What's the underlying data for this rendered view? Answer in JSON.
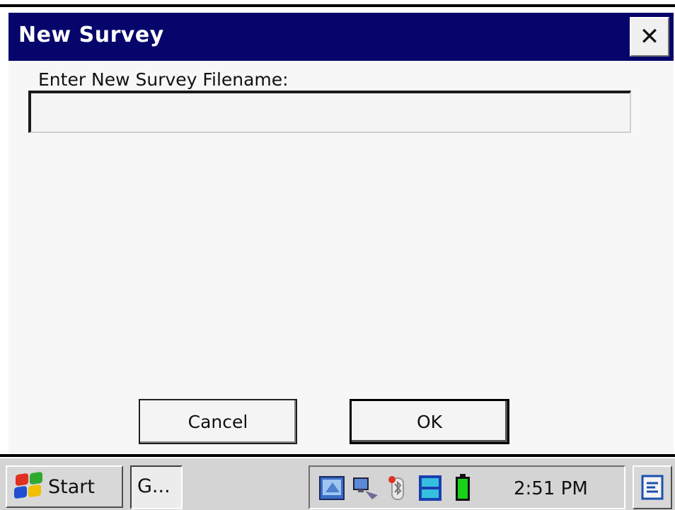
{
  "window": {
    "title": "New Survey",
    "close_glyph": "✕",
    "title_color": "#05056b"
  },
  "form": {
    "prompt_label": "Enter New Survey Filename:",
    "filename_value": "",
    "cancel_label": "Cancel",
    "ok_label": "OK"
  },
  "taskbar": {
    "start_label": "Start",
    "task_button_label": "G...",
    "clock": "2:51 PM",
    "tray_icons": [
      "network-icon",
      "connectivity-icon",
      "bluetooth-icon",
      "dtg-client-icon",
      "battery-icon"
    ],
    "desktop_icon": "desktop-icon"
  }
}
